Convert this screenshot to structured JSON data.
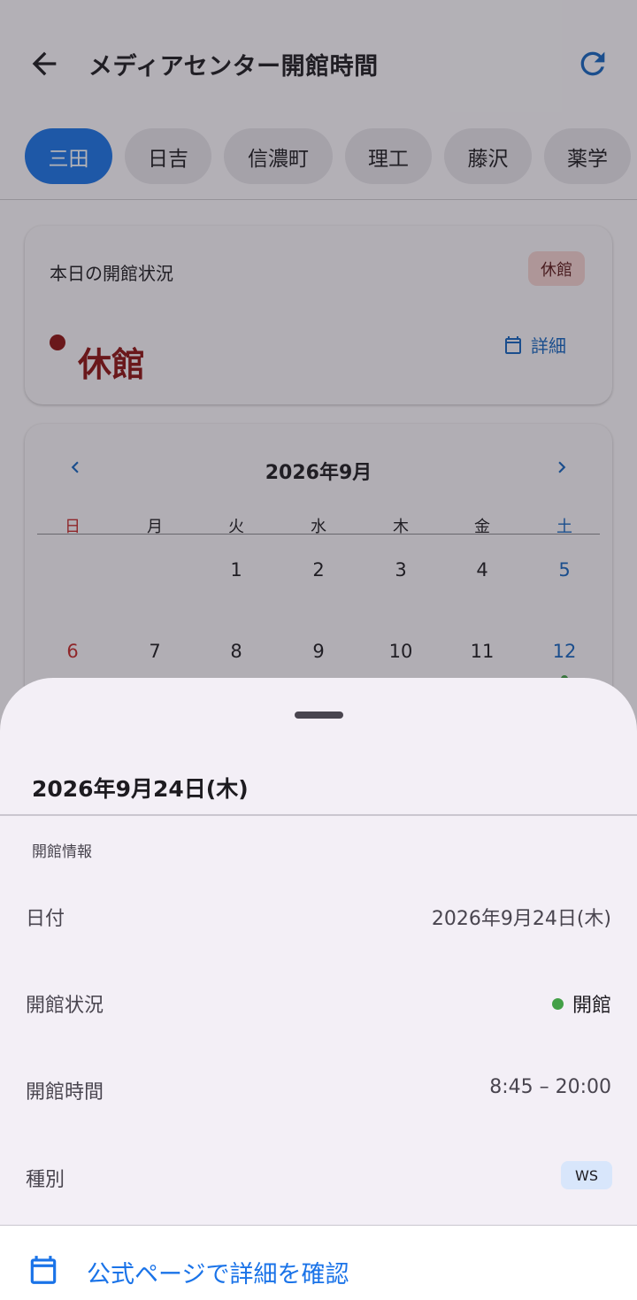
{
  "appbar": {
    "title": "メディアセンター開館時間",
    "back_icon": "arrow-left-icon",
    "refresh_icon": "refresh-icon"
  },
  "campuses": [
    {
      "label": "三田",
      "active": true
    },
    {
      "label": "日吉",
      "active": false
    },
    {
      "label": "信濃町",
      "active": false
    },
    {
      "label": "理工",
      "active": false
    },
    {
      "label": "藤沢",
      "active": false
    },
    {
      "label": "薬学",
      "active": false
    }
  ],
  "today": {
    "label": "本日の開館状況",
    "badge": "休館",
    "status": "休館",
    "detail_link": "詳細"
  },
  "calendar": {
    "title": "2026年9月",
    "weekdays": [
      "日",
      "月",
      "火",
      "水",
      "木",
      "金",
      "土"
    ],
    "week1": [
      "1",
      "2",
      "3",
      "4",
      "5"
    ],
    "week2": [
      "6",
      "7",
      "8",
      "9",
      "10",
      "11",
      "12"
    ]
  },
  "sheet": {
    "title": "2026年9月24日(木)",
    "section": "開館情報",
    "rows": {
      "date_label": "日付",
      "date_value": "2026年9月24日(木)",
      "status_label": "開館状況",
      "status_value": "開館",
      "hours_label": "開館時間",
      "hours_value": "8:45 – 20:00",
      "type_label": "種別",
      "type_value": "WS"
    },
    "footer_link": "公式ページで詳細を確認"
  },
  "colors": {
    "accent": "#1a73e8",
    "closed": "#8e1212",
    "open": "#43a047",
    "sunday": "#c62828",
    "saturday": "#1565c0"
  }
}
